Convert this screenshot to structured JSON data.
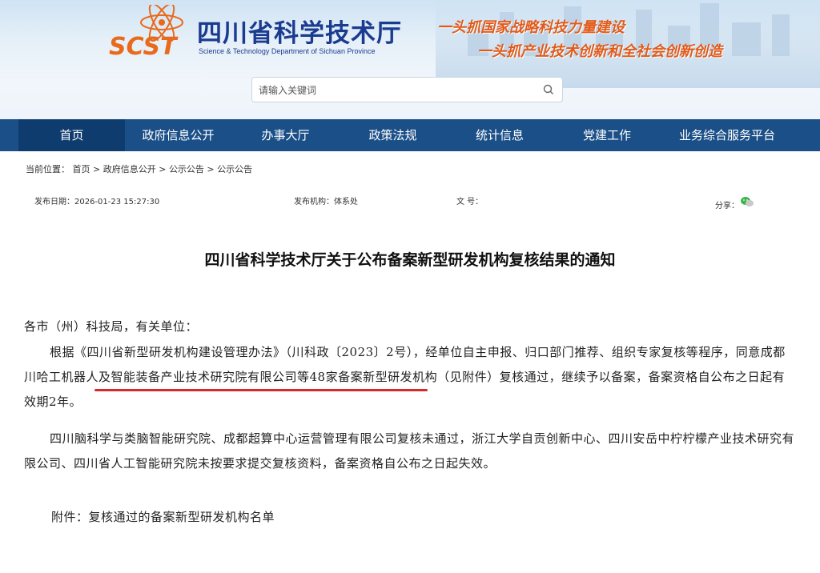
{
  "header": {
    "title": "四川省科学技术厅",
    "subtitle": "Science & Technology Department of Sichuan Province",
    "logo_text": "SCST",
    "slogan1": "一头抓国家战略科技力量建设",
    "slogan2": "一头抓产业技术创新和全社会创新创造",
    "search_placeholder": "请输入关键词"
  },
  "colors": {
    "nav_bg": "#1b4f88",
    "nav_active": "#0f3c6e",
    "slogan": "#e05b1b",
    "title": "#1a3b8f",
    "underline": "#d62b2b"
  },
  "nav": {
    "items": [
      "首页",
      "政府信息公开",
      "办事大厅",
      "政策法规",
      "统计信息",
      "党建工作",
      "业务综合服务平台"
    ]
  },
  "breadcrumb": {
    "prefix": "当前位置：",
    "items": [
      "首页",
      "政府信息公开",
      "公示公告",
      "公示公告"
    ],
    "sep": " > "
  },
  "meta": {
    "date_label": "发布日期：",
    "date_value": "2026-01-23 15:27:30",
    "org_label": "发布机构：",
    "org_value": "体系处",
    "docno_label": "文 号：",
    "docno_value": "",
    "share_label": "分享："
  },
  "article": {
    "title": "四川省科学技术厅关于公布备案新型研发机构复核结果的通知",
    "salutation": "各市（州）科技局，有关单位：",
    "para1_a": "根据《四川省新型研发机构建设管理办法》（川科政〔2023〕2号），经单位自主申报、归口部门推荐、组织专家复核等程序，同意",
    "para1_highlight": "成都川哈工机器人及智能装备产业技术研究院有限公司",
    "para1_b": "等48家备案新型研发机构（见附件）复核通过，继续予以备案，备案资格自公布之日起有效期2年。",
    "para2": "四川脑科学与类脑智能研究院、成都超算中心运营管理有限公司复核未通过，浙江大学自贡创新中心、四川安岳中柠柠檬产业技术研究有限公司、四川省人工智能研究院未按要求提交复核资料，备案资格自公布之日起失效。",
    "attachment": "附件：复核通过的备案新型研发机构名单"
  }
}
